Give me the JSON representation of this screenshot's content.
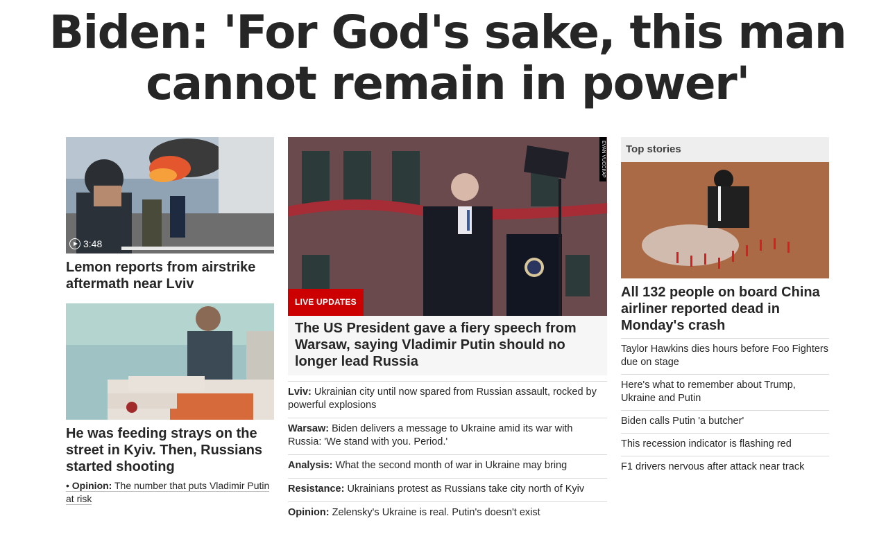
{
  "headline": "Biden: 'For God's sake, this man cannot remain in power'",
  "left": {
    "story1": {
      "duration": "3:48",
      "title": "Lemon reports from airstrike aftermath near Lviv"
    },
    "story2": {
      "title": "He was feeding strays on the street in Kyiv. Then, Russians started shooting"
    },
    "opinion": {
      "bullet": "•",
      "label": "Opinion:",
      "text": "The number that puts Vladimir Putin at risk"
    }
  },
  "middle": {
    "badge": "LIVE UPDATES",
    "photo_credit": "EVAN VUCCI/AP",
    "title": "The US President gave a fiery speech from Warsaw, saying Vladimir Putin should no longer lead Russia",
    "links": [
      {
        "label": "Lviv:",
        "text": "Ukrainian city until now spared from Russian assault, rocked by powerful explosions"
      },
      {
        "label": "Warsaw:",
        "text": "Biden delivers a message to Ukraine amid its war with Russia: 'We stand with you. Period.'"
      },
      {
        "label": "Analysis:",
        "text": "What the second month of war in Ukraine may bring"
      },
      {
        "label": "Resistance:",
        "text": "Ukrainians protest as Russians take city north of Kyiv"
      },
      {
        "label": "Opinion:",
        "text": "Zelensky's Ukraine is real. Putin's doesn't exist"
      }
    ]
  },
  "right": {
    "section_label": "Top stories",
    "title": "All 132 people on board China airliner reported dead in Monday's crash",
    "links": [
      "Taylor Hawkins dies hours before Foo Fighters due on stage",
      "Here's what to remember about Trump, Ukraine and Putin",
      "Biden calls Putin 'a butcher'",
      "This recession indicator is flashing red",
      "F1 drivers nervous after attack near track"
    ]
  },
  "colors": {
    "live_badge": "#cc0000",
    "headline_text": "#262626"
  },
  "icons": {
    "video": "play-circle-icon"
  }
}
